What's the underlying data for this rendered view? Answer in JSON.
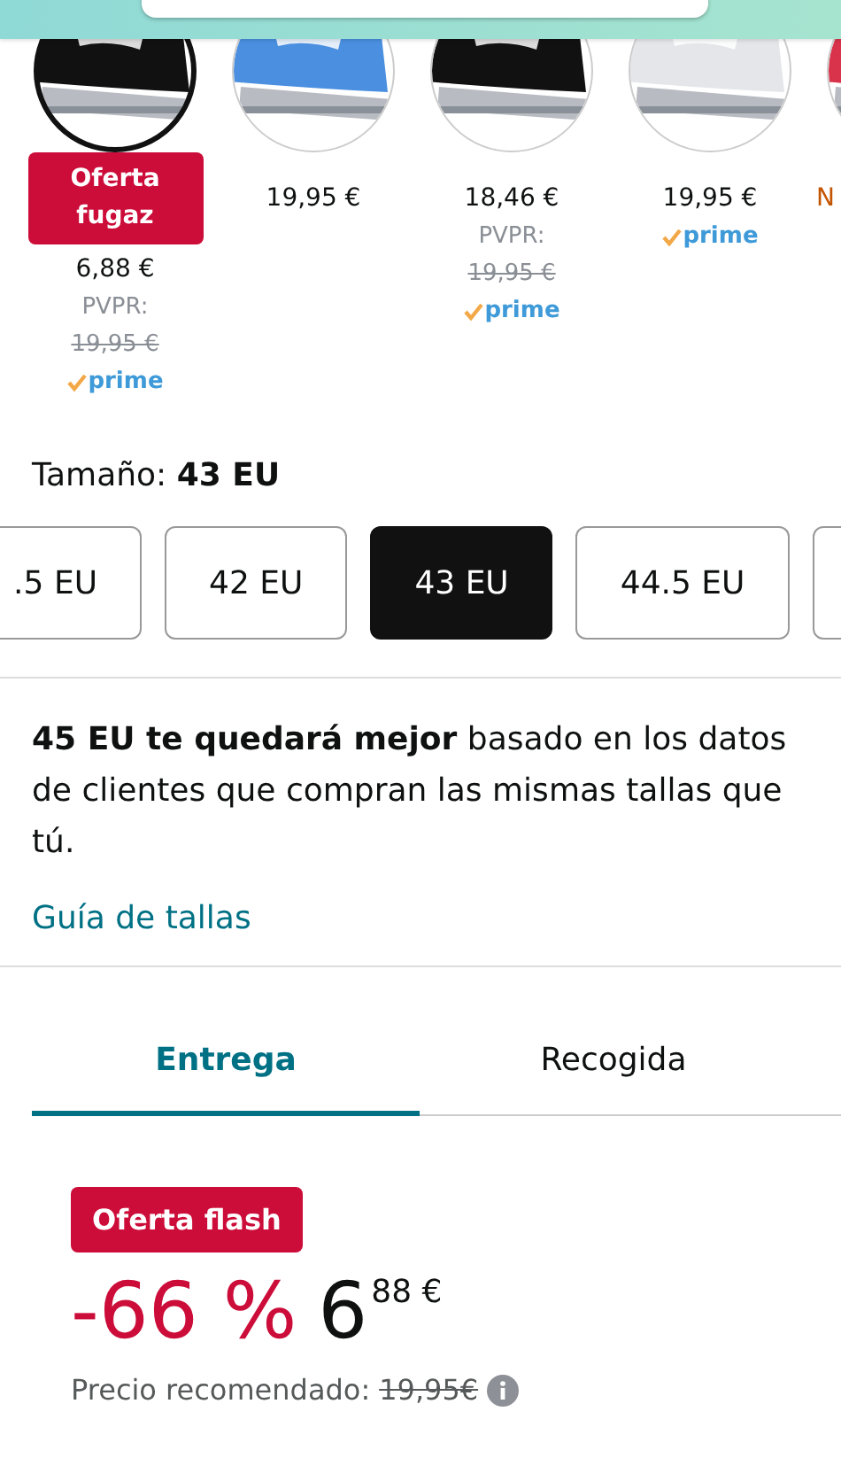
{
  "swatches": [
    {
      "selected": true,
      "color": "#111111",
      "badge": "Oferta\nfugaz",
      "price": "6,88 €",
      "list_label": "PVPR:",
      "list_price": "19,95 €",
      "prime": "prime"
    },
    {
      "selected": false,
      "color": "#4a8fe0",
      "price": "19,95 €"
    },
    {
      "selected": false,
      "color": "#111111",
      "price": "18,46 €",
      "list_label": "PVPR:",
      "list_price": "19,95 €",
      "prime": "prime"
    },
    {
      "selected": false,
      "color": "#e4e6ea",
      "price": "19,95 €",
      "prime": "prime"
    },
    {
      "selected": false,
      "color": "#d8334a",
      "note": "N"
    }
  ],
  "size_label": "Tamaño: **43 EU**",
  "sizes": [
    {
      "label": ".5 EU",
      "selected": false
    },
    {
      "label": "42 EU",
      "selected": false
    },
    {
      "label": "43 EU",
      "selected": true
    },
    {
      "label": "44.5 EU",
      "selected": false
    },
    {
      "selected": false
    }
  ],
  "fit_note": "**45 EU te quedará mejor** basado en los datos de clientes que compran las mismas tallas que tú.",
  "size_guide_link": "Guía de tallas",
  "tabs": [
    {
      "label": "Entrega",
      "selected": true
    },
    {
      "label": "Recogida",
      "selected": false
    }
  ],
  "offer_badge": "Oferta flash",
  "discount": "-66 %",
  "price_whole": "6",
  "price_fraction": "88 €",
  "recommended_label": "Precio recomendado:",
  "recommended_price": "19,95€"
}
